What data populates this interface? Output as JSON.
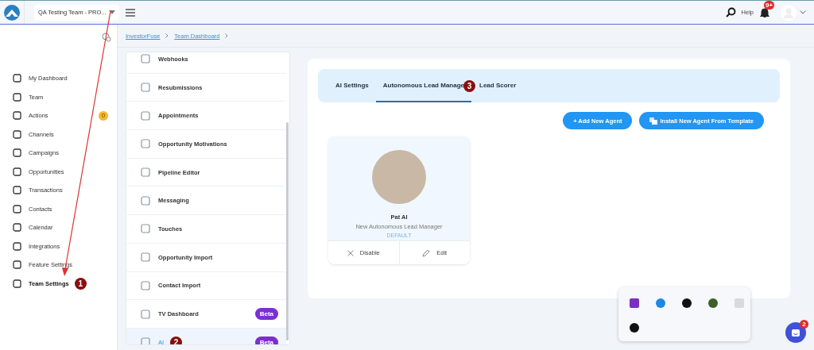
{
  "header": {
    "team_select": "QA Testing Team - PRO...",
    "help": "Help",
    "notification_badge": "9+"
  },
  "sidebar": {
    "items": [
      {
        "label": "My Dashboard",
        "selected": false
      },
      {
        "label": "Team",
        "selected": false
      },
      {
        "label": "Actions",
        "selected": false,
        "badge": "0"
      },
      {
        "label": "Channels",
        "selected": false
      },
      {
        "label": "Campaigns",
        "selected": false
      },
      {
        "label": "Opportunities",
        "selected": false
      },
      {
        "label": "Transactions",
        "selected": false
      },
      {
        "label": "Contacts",
        "selected": false
      },
      {
        "label": "Calendar",
        "selected": false
      },
      {
        "label": "Integrations",
        "selected": false
      },
      {
        "label": "Feature Settings",
        "selected": false
      },
      {
        "label": "Team Settings",
        "selected": true,
        "marker": "1"
      }
    ]
  },
  "breadcrumb": [
    "InvestorFuse",
    "Team Dashboard"
  ],
  "settings_menu": {
    "items": [
      {
        "label": "Webhooks",
        "selected": false
      },
      {
        "label": "Resubmissions",
        "selected": false
      },
      {
        "label": "Appointments",
        "selected": false
      },
      {
        "label": "Opportunity Motivations",
        "selected": false
      },
      {
        "label": "Pipeline Editor",
        "selected": false
      },
      {
        "label": "Messaging",
        "selected": false
      },
      {
        "label": "Touches",
        "selected": false
      },
      {
        "label": "Opportunity Import",
        "selected": false
      },
      {
        "label": "Contact Import",
        "selected": false
      },
      {
        "label": "TV Dashboard",
        "selected": false,
        "badge": "Beta"
      },
      {
        "label": "AI",
        "selected": true,
        "badge": "Beta",
        "marker": "2"
      }
    ]
  },
  "tabs": [
    {
      "label": "AI Settings",
      "selected": false
    },
    {
      "label": "Autonomous Lead Manage",
      "selected": true,
      "marker": "3"
    },
    {
      "label": "Lead Scorer",
      "selected": false
    }
  ],
  "buttons": [
    "+ Add New Agent",
    "Install New Agent From Template"
  ],
  "agent": {
    "name": "Pat AI",
    "role": "New Autonomous Lead Manager",
    "tag": "DEFAULT",
    "actions": [
      "Disable",
      "Edit"
    ]
  },
  "chat": {
    "badge": "2"
  }
}
